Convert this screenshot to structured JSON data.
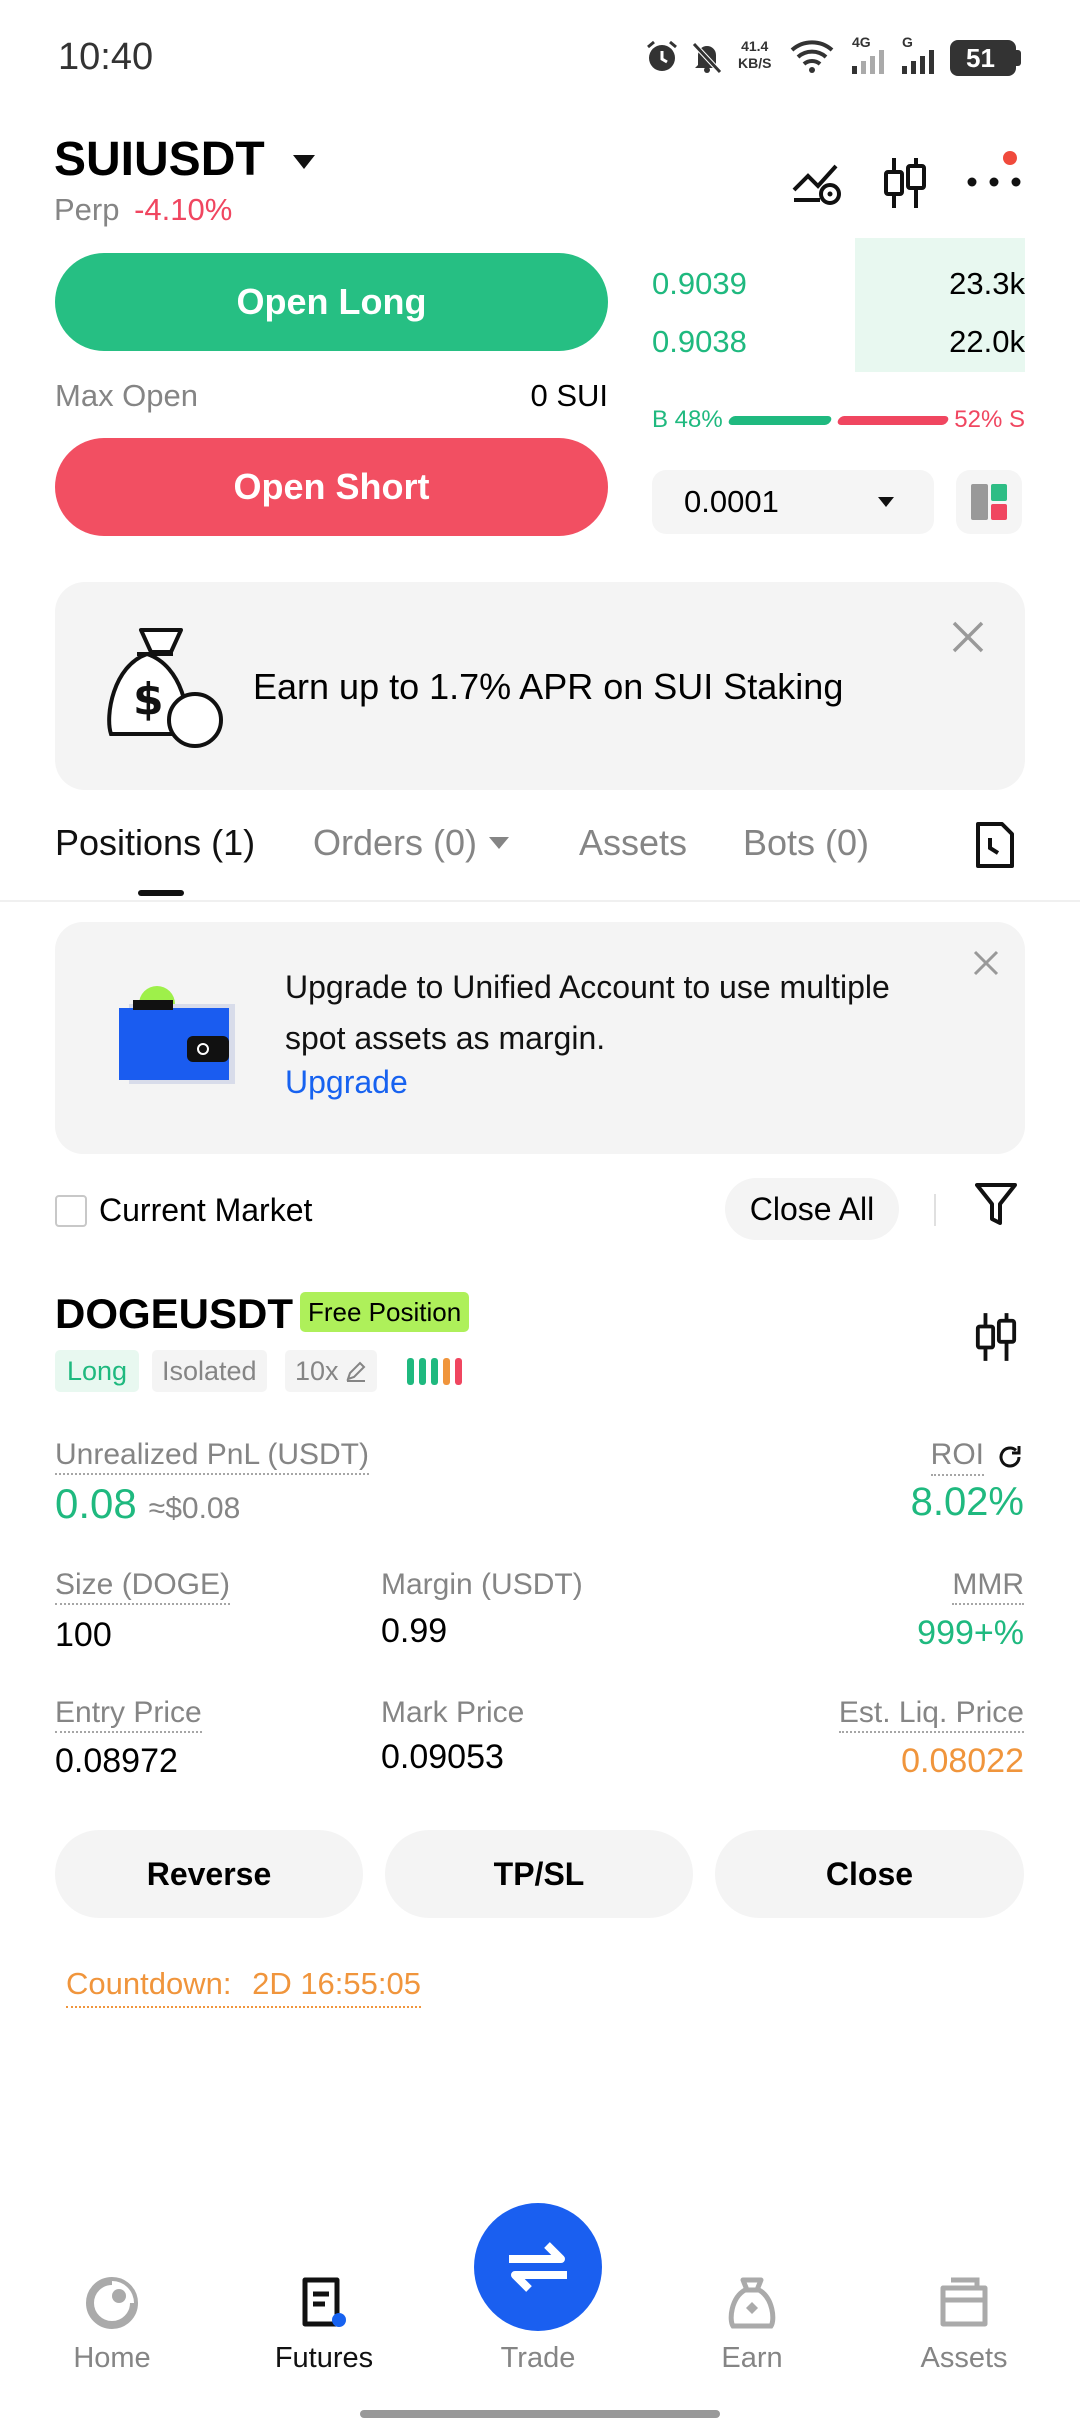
{
  "status_bar": {
    "time": "10:40",
    "speed_top": "41.4",
    "speed_bottom": "KB/S",
    "net1": "4G",
    "net2": "G",
    "battery": "51"
  },
  "header": {
    "symbol": "SUIUSDT",
    "contract_type": "Perp",
    "change": "-4.10%"
  },
  "trade": {
    "open_long": "Open Long",
    "max_open_label": "Max Open",
    "max_open_value": "0 SUI",
    "open_short": "Open Short"
  },
  "orderbook": {
    "rows": [
      {
        "price": "0.9039",
        "size": "23.3k"
      },
      {
        "price": "0.9038",
        "size": "22.0k"
      }
    ],
    "buy_label": "B 48%",
    "sell_label": "52% S",
    "buy_ratio": 0.48,
    "precision": "0.0001"
  },
  "promo_banner": {
    "text": "Earn up to 1.7% APR on SUI Staking"
  },
  "tabs": [
    {
      "label": "Positions (1)",
      "active": true
    },
    {
      "label": "Orders (0)",
      "active": false
    },
    {
      "label": "Assets",
      "active": false
    },
    {
      "label": "Bots (0)",
      "active": false
    }
  ],
  "upgrade_card": {
    "text": "Upgrade to Unified Account to use multiple spot assets as margin.",
    "link": "Upgrade"
  },
  "filter_row": {
    "current_market": "Current Market",
    "close_all": "Close All"
  },
  "position": {
    "symbol": "DOGEUSDT",
    "badge": "Free Position",
    "side": "Long",
    "margin_mode": "Isolated",
    "leverage": "10x",
    "pnl_label": "Unrealized PnL (USDT)",
    "pnl_value": "0.08",
    "pnl_usd": "≈$0.08",
    "roi_label": "ROI",
    "roi_value": "8.02%",
    "size_label": "Size (DOGE)",
    "size_value": "100",
    "margin_label": "Margin (USDT)",
    "margin_value": "0.99",
    "mmr_label": "MMR",
    "mmr_value": "999+%",
    "entry_label": "Entry Price",
    "entry_value": "0.08972",
    "mark_label": "Mark Price",
    "mark_value": "0.09053",
    "liq_label": "Est. Liq. Price",
    "liq_value": "0.08022",
    "btn_reverse": "Reverse",
    "btn_tpsl": "TP/SL",
    "btn_close": "Close",
    "countdown_label": "Countdown:",
    "countdown_value": "2D 16:55:05"
  },
  "bottom_nav": [
    {
      "label": "Home",
      "active": false
    },
    {
      "label": "Futures",
      "active": true
    },
    {
      "label": "Trade",
      "active": false
    },
    {
      "label": "Earn",
      "active": false
    },
    {
      "label": "Assets",
      "active": false
    }
  ],
  "colors": {
    "green": "#1fb97f",
    "red": "#f04660",
    "blue": "#1762f0",
    "orange": "#f0953c",
    "badge_green": "#aef05a"
  }
}
